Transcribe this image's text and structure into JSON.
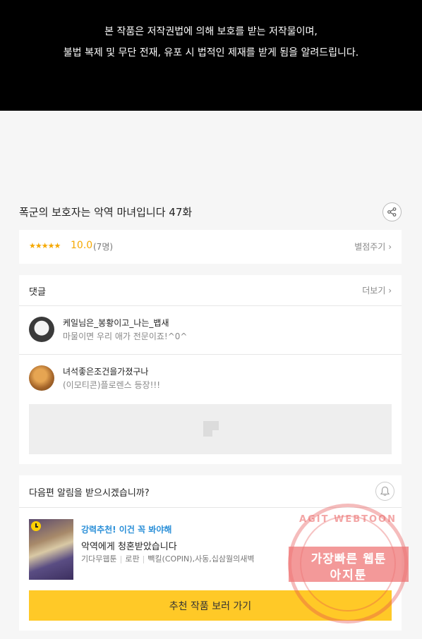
{
  "notice": {
    "line1": "본 작품은 저작권법에 의해 보호를 받는 저작물이며,",
    "line2": "불법 복제 및 무단 전재, 유포 시 법적인 제재를 받게 됨을 알려드립니다."
  },
  "episode": {
    "title": "폭군의 보호자는 악역 마녀입니다 47화"
  },
  "rating": {
    "stars": "★★★★★",
    "score": "10.0",
    "count": "(7명)",
    "rate_link": "별점주기",
    "star_color": "#f5a800"
  },
  "comments": {
    "header": "댓글",
    "more": "더보기",
    "items": [
      {
        "nick": "케일님은_봉황이고_나는_뱁새",
        "text": "마물이면 우리 애가 전문이죠!^0^"
      },
      {
        "nick": "녀석좋은조건을가졌구나",
        "text": "(이모티콘)플로렌스 등장!!!"
      }
    ]
  },
  "next": {
    "question": "다음편 알림을 받으시겠습니까?",
    "rec_tag": "강력추천! 이건 꼭 봐야해",
    "rec_title": "악역에게 청혼받았습니다",
    "meta": [
      "기다무웹툰",
      "로판",
      "빽킬(COPIN),사동,십삼월의새벽"
    ],
    "button": "추천 작품 보러 가기",
    "button_color": "#ffc927",
    "tag_color": "#2a8fd8"
  },
  "watermark": {
    "arc": "AGIT WEBTOON",
    "line1": "가장빠른 웹툰",
    "line2": "아지툰"
  }
}
